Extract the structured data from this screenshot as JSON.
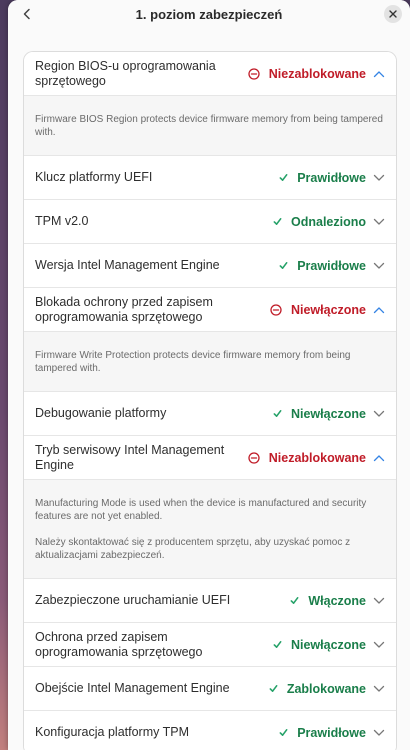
{
  "dialog": {
    "title": "1. poziom zabezpieczeń"
  },
  "items": [
    {
      "label": "Region BIOS-u oprogramowania sprzętowego",
      "status": "Niezablokowane",
      "state": "bad",
      "expanded": true,
      "description": [
        "Firmware BIOS Region protects device firmware memory from being tampered with."
      ]
    },
    {
      "label": "Klucz platformy UEFI",
      "status": "Prawidłowe",
      "state": "ok",
      "expanded": false
    },
    {
      "label": "TPM v2.0",
      "status": "Odnaleziono",
      "state": "ok",
      "expanded": false
    },
    {
      "label": "Wersja Intel Management Engine",
      "status": "Prawidłowe",
      "state": "ok",
      "expanded": false
    },
    {
      "label": "Blokada ochrony przed zapisem oprogramowania sprzętowego",
      "status": "Niewłączone",
      "state": "bad",
      "expanded": true,
      "description": [
        "Firmware Write Protection protects device firmware memory from being tampered with."
      ]
    },
    {
      "label": "Debugowanie platformy",
      "status": "Niewłączone",
      "state": "ok",
      "expanded": false
    },
    {
      "label": "Tryb serwisowy Intel Management Engine",
      "status": "Niezablokowane",
      "state": "bad",
      "expanded": true,
      "description": [
        "Manufacturing Mode is used when the device is manufactured and security features are not yet enabled.",
        "Należy skontaktować się z producentem sprzętu, aby uzyskać pomoc z aktualizacjami zabezpieczeń."
      ]
    },
    {
      "label": "Zabezpieczone uruchamianie UEFI",
      "status": "Włączone",
      "state": "ok",
      "expanded": false
    },
    {
      "label": "Ochrona przed zapisem oprogramowania sprzętowego",
      "status": "Niewłączone",
      "state": "ok",
      "expanded": false
    },
    {
      "label": "Obejście Intel Management Engine",
      "status": "Zablokowane",
      "state": "ok",
      "expanded": false
    },
    {
      "label": "Konfiguracja platformy TPM",
      "status": "Prawidłowe",
      "state": "ok",
      "expanded": false
    }
  ]
}
